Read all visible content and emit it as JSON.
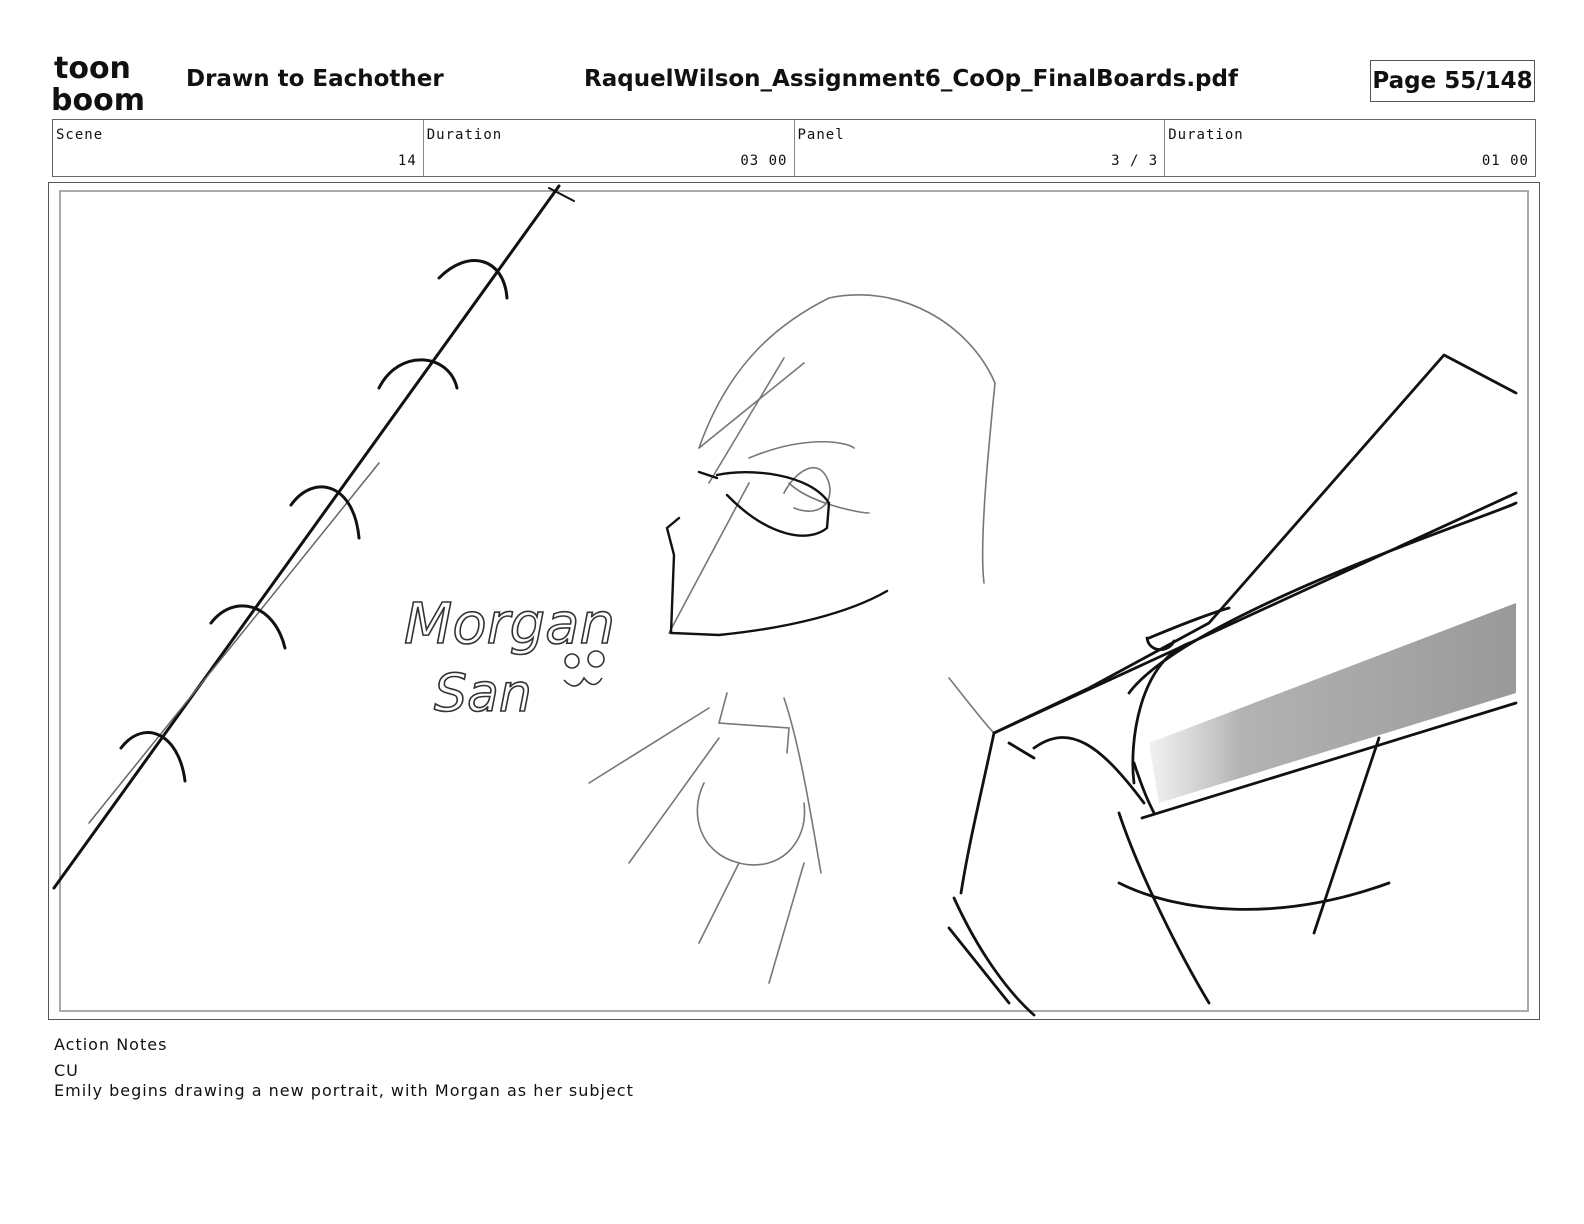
{
  "header": {
    "logo_text_top": "toon",
    "logo_text_bottom": "boom",
    "project_title": "Drawn to Eachother",
    "file_name": "RaquelWilson_Assignment6_CoOp_FinalBoards.pdf",
    "page_label": "Page",
    "page_number": "55/148"
  },
  "info": {
    "scene_label": "Scene",
    "scene_value": "14",
    "scene_duration_label": "Duration",
    "scene_duration_value": "03 00",
    "panel_label": "Panel",
    "panel_value": "3 / 3",
    "panel_duration_label": "Duration",
    "panel_duration_value": "01 00"
  },
  "panel": {
    "sketch_text_line1": "Morgan",
    "sketch_text_line2": "San"
  },
  "notes": {
    "label": "Action Notes",
    "shot": "CU",
    "description": "Emily begins drawing a new portrait, with Morgan as her subject"
  }
}
